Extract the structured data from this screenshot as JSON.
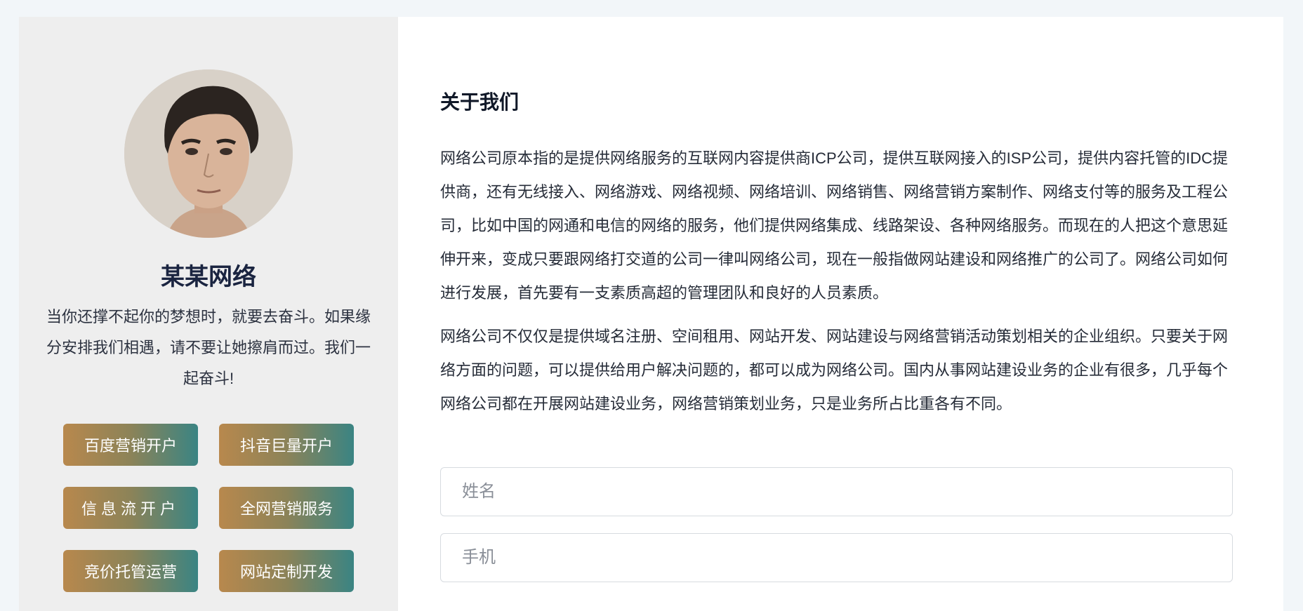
{
  "profile": {
    "name": "某某网络",
    "motto": "当你还撑不起你的梦想时，就要去奋斗。如果缘分安排我们相遇，请不要让她擦肩而过。我们一起奋斗!"
  },
  "services": [
    {
      "label": "百度营销开户"
    },
    {
      "label": "抖音巨量开户"
    },
    {
      "label": "信息流开户"
    },
    {
      "label": "全网营销服务"
    },
    {
      "label": "竞价托管运营"
    },
    {
      "label": "网站定制开发"
    }
  ],
  "about": {
    "title": "关于我们",
    "paragraphs": [
      "网络公司原本指的是提供网络服务的互联网内容提供商ICP公司，提供互联网接入的ISP公司，提供内容托管的IDC提供商，还有无线接入、网络游戏、网络视频、网络培训、网络销售、网络营销方案制作、网络支付等的服务及工程公司，比如中国的网通和电信的网络的服务，他们提供网络集成、线路架设、各种网络服务。而现在的人把这个意思延伸开来，变成只要跟网络打交道的公司一律叫网络公司，现在一般指做网站建设和网络推广的公司了。网络公司如何进行发展，首先要有一支素质高超的管理团队和良好的人员素质。",
      "网络公司不仅仅是提供域名注册、空间租用、网站开发、网站建设与网络营销活动策划相关的企业组织。只要关于网络方面的问题，可以提供给用户解决问题的，都可以成为网络公司。国内从事网站建设业务的企业有很多，几乎每个网络公司都在开展网站建设业务，网络营销策划业务，只是业务所占比重各有不同。"
    ]
  },
  "form": {
    "name_placeholder": "姓名",
    "phone_placeholder": "手机"
  },
  "colors": {
    "button_gradient_start": "#b8884d",
    "button_gradient_end": "#3a8483",
    "left_panel": "#eeeeee",
    "page_bg": "#f2f6f9"
  }
}
